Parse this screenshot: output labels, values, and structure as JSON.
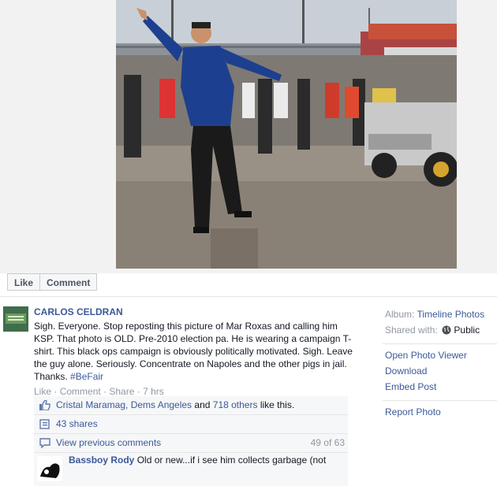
{
  "photo_actions": {
    "like_label": "Like",
    "comment_label": "Comment"
  },
  "post": {
    "author": "CARLOS CELDRAN",
    "text": "Sigh. Everyone. Stop reposting this picture of Mar Roxas and calling him KSP. That photo is OLD. Pre-2010 election pa. He is wearing a campaign T-shirt. This black ops campaign is obviously politically motivated. Sigh. Leave the guy alone. Seriously. Concentrate on Napoles and the other pigs in jail. Thanks.",
    "hashtag": "#BeFair",
    "meta": {
      "like": "Like",
      "comment": "Comment",
      "share": "Share",
      "time": "7 hrs",
      "sep": " · "
    }
  },
  "likes": {
    "names": "Cristal Maramag, Dems Angeles",
    "and": " and ",
    "others": "718 others",
    "suffix": " like this."
  },
  "shares": {
    "text": "43 shares"
  },
  "previous": {
    "label": "View previous comments",
    "count": "49 of 63"
  },
  "comment": {
    "name": "Bassboy Rody",
    "text": "Old or new...if i see him collects garbage (not"
  },
  "sidebar": {
    "album_label": "Album:",
    "album_value": "Timeline Photos",
    "shared_label": "Shared with:",
    "shared_value": "Public",
    "links": [
      "Open Photo Viewer",
      "Download",
      "Embed Post"
    ],
    "report": "Report Photo"
  },
  "colors": {
    "link": "#3b5998",
    "muted": "#9197a3",
    "shirt": "#1d3f8f"
  },
  "icons": {
    "likes": "thumbs-up-icon",
    "shares": "share-icon",
    "comments": "comment-bubble-icon",
    "public": "globe-icon"
  }
}
